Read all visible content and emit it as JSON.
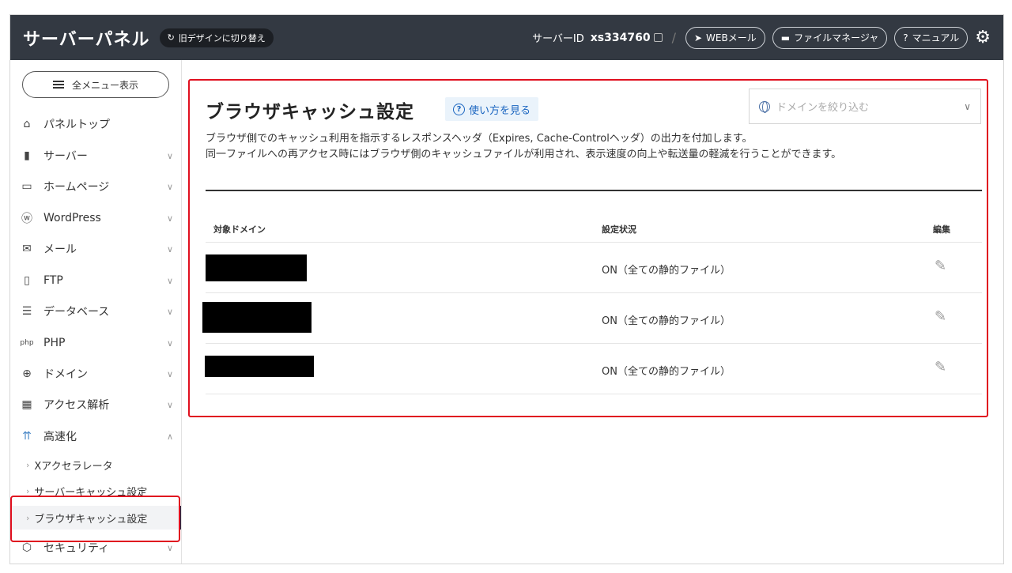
{
  "header": {
    "brand": "サーバーパネル",
    "old_design_label": "旧デザインに切り替え",
    "server_id_label": "サーバーID",
    "server_id": "xs334760",
    "separator": "/",
    "buttons": [
      {
        "label": "WEBメール",
        "icon": "send-icon"
      },
      {
        "label": "ファイルマネージャ",
        "icon": "folder-icon"
      },
      {
        "label": "マニュアル",
        "icon": "help-icon"
      }
    ]
  },
  "sidebar": {
    "all_menu_label": "全メニュー表示",
    "items": [
      {
        "label": "パネルトップ",
        "icon": "home-icon"
      },
      {
        "label": "サーバー",
        "icon": "server-icon"
      },
      {
        "label": "ホームページ",
        "icon": "window-icon"
      },
      {
        "label": "WordPress",
        "icon": "wordpress-icon"
      },
      {
        "label": "メール",
        "icon": "mail-icon"
      },
      {
        "label": "FTP",
        "icon": "monitor-icon"
      },
      {
        "label": "データベース",
        "icon": "database-icon"
      },
      {
        "label": "PHP",
        "icon": "php-icon"
      },
      {
        "label": "ドメイン",
        "icon": "globe-icon"
      },
      {
        "label": "アクセス解析",
        "icon": "chart-icon"
      },
      {
        "label": "高速化",
        "icon": "speed-icon"
      },
      {
        "label": "セキュリティ",
        "icon": "shield-icon"
      }
    ],
    "sub_items": [
      {
        "label": "Xアクセラレータ"
      },
      {
        "label": "サーバーキャッシュ設定"
      },
      {
        "label": "ブラウザキャッシュ設定"
      }
    ]
  },
  "main": {
    "title": "ブラウザキャッシュ設定",
    "howto_label": "使い方を見る",
    "domain_filter_placeholder": "ドメインを絞り込む",
    "description_line1": "ブラウザ側でのキャッシュ利用を指示するレスポンスヘッダ（Expires, Cache-Controlヘッダ）の出力を付加します。",
    "description_line2": "同一ファイルへの再アクセス時にはブラウザ側のキャッシュファイルが利用され、表示速度の向上や転送量の軽減を行うことができます。",
    "table": {
      "headers": [
        "対象ドメイン",
        "設定状況",
        "編集"
      ],
      "rows": [
        {
          "domain": "",
          "status": "ON（全ての静的ファイル）"
        },
        {
          "domain": "",
          "status": "ON（全ての静的ファイル）"
        },
        {
          "domain": "",
          "status": "ON（全ての静的ファイル）"
        }
      ]
    }
  }
}
